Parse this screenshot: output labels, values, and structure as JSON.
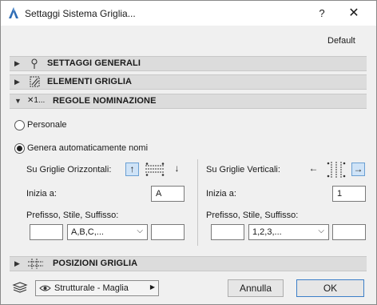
{
  "window": {
    "title": "Settaggi Sistema Griglia...",
    "help_label": "?",
    "close_label": "✕",
    "default_label": "Default"
  },
  "sections": {
    "general": {
      "label": "SETTAGGI GENERALI",
      "icon": "pin-icon"
    },
    "elements": {
      "label": "ELEMENTI GRIGLIA",
      "icon": "grid-element-icon"
    },
    "naming": {
      "label": "REGOLE NOMINAZIONE",
      "icon_text": "✕1..."
    },
    "positions": {
      "label": "POSIZIONI GRIGLIA",
      "icon": "grid-positions-icon"
    }
  },
  "naming": {
    "personal_label": "Personale",
    "auto_label": "Genera automaticamente nomi",
    "selected": "auto",
    "horizontal": {
      "label": "Su Griglie Orizzontali:",
      "start_label": "Inizia a:",
      "start_value": "A",
      "format_label": "Prefisso, Stile, Suffisso:",
      "prefix_value": "",
      "style_value": "A,B,C,...",
      "suffix_value": ""
    },
    "vertical": {
      "label": "Su Griglie Verticali:",
      "start_label": "Inizia a:",
      "start_value": "1",
      "format_label": "Prefisso, Stile, Suffisso:",
      "prefix_value": "",
      "style_value": "1,2,3,...",
      "suffix_value": ""
    }
  },
  "footer": {
    "layer_value": "Strutturale - Maglia",
    "cancel_label": "Annulla",
    "ok_label": "OK"
  },
  "colors": {
    "accent": "#3c7fc8",
    "toggle_active": "#cfe3f7"
  }
}
